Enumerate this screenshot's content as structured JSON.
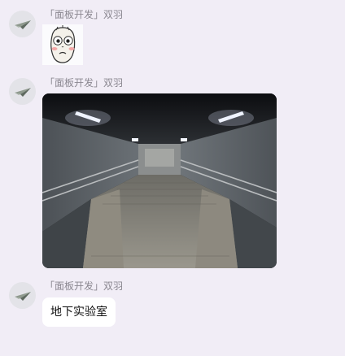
{
  "messages": [
    {
      "sender": "「面板开发」双羽",
      "avatar_icon": "paper-plane-icon",
      "content_type": "sticker",
      "sticker_icon": "shocked-face-meme-sticker"
    },
    {
      "sender": "「面板开发」双羽",
      "avatar_icon": "paper-plane-icon",
      "content_type": "image",
      "image_subject": "underground-passage-photo"
    },
    {
      "sender": "「面板开发」双羽",
      "avatar_icon": "paper-plane-icon",
      "content_type": "text",
      "text": "地下实验室"
    }
  ],
  "colors": {
    "background": "#f1edf6",
    "bubble": "#ffffff",
    "sender_text": "#8a8790"
  }
}
